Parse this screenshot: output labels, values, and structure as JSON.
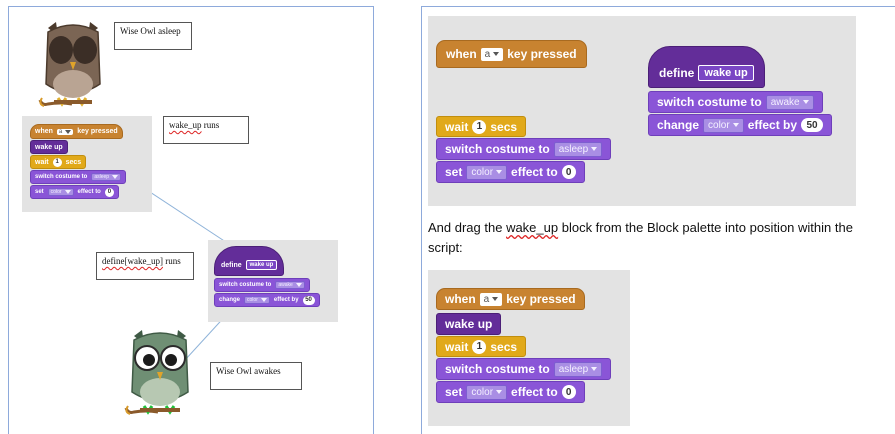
{
  "left": {
    "note_asleep": "Wise Owl asleep",
    "note_wake_fn": "wake_up",
    "note_wake_rest": " runs",
    "note_define_fn": "define[wake_up]",
    "note_define_rest": " runs",
    "note_awakes": "Wise Owl awakes",
    "script": {
      "when": "when",
      "key": "a",
      "key_pressed": "key pressed",
      "wake_up": "wake up",
      "wait": "wait",
      "wait_num": "1",
      "secs": "secs",
      "switch": "switch costume to",
      "costume": "asleep",
      "set": "set",
      "effect": "color",
      "effect_to": "effect to",
      "effect_num": "0"
    },
    "define_script": {
      "define": "define",
      "name": "wake up",
      "switch": "switch costume to",
      "costume": "awake",
      "change": "change",
      "effect": "color",
      "effect_by": "effect by",
      "num": "50"
    }
  },
  "right": {
    "top": {
      "when": "when",
      "key": "a",
      "key_pressed": "key pressed",
      "wait": "wait",
      "wait_num": "1",
      "secs": "secs",
      "switch": "switch costume to",
      "costume": "asleep",
      "set": "set",
      "effect": "color",
      "effect_to": "effect to",
      "effect_num": "0",
      "define": "define",
      "name": "wake up",
      "switch2": "switch costume to",
      "costume2": "awake",
      "change": "change",
      "effect2": "color",
      "effect_by": "effect by",
      "num2": "50"
    },
    "text_before": "And drag the ",
    "text_fn": "wake_up",
    "text_after": " block from the Block palette into position within the",
    "text_line2": "script:",
    "bottom": {
      "when": "when",
      "key": "a",
      "key_pressed": "key pressed",
      "wake_up": "wake up",
      "wait": "wait",
      "wait_num": "1",
      "secs": "secs",
      "switch": "switch costume to",
      "costume": "asleep",
      "set": "set",
      "effect": "color",
      "effect_to": "effect to",
      "effect_num": "0"
    }
  },
  "colors": {
    "events": "#c88330",
    "control": "#e1a91a",
    "looks": "#8a55d7",
    "custom": "#632d99",
    "panel_border": "#8eaadb",
    "script_area": "#e3e3e3"
  }
}
